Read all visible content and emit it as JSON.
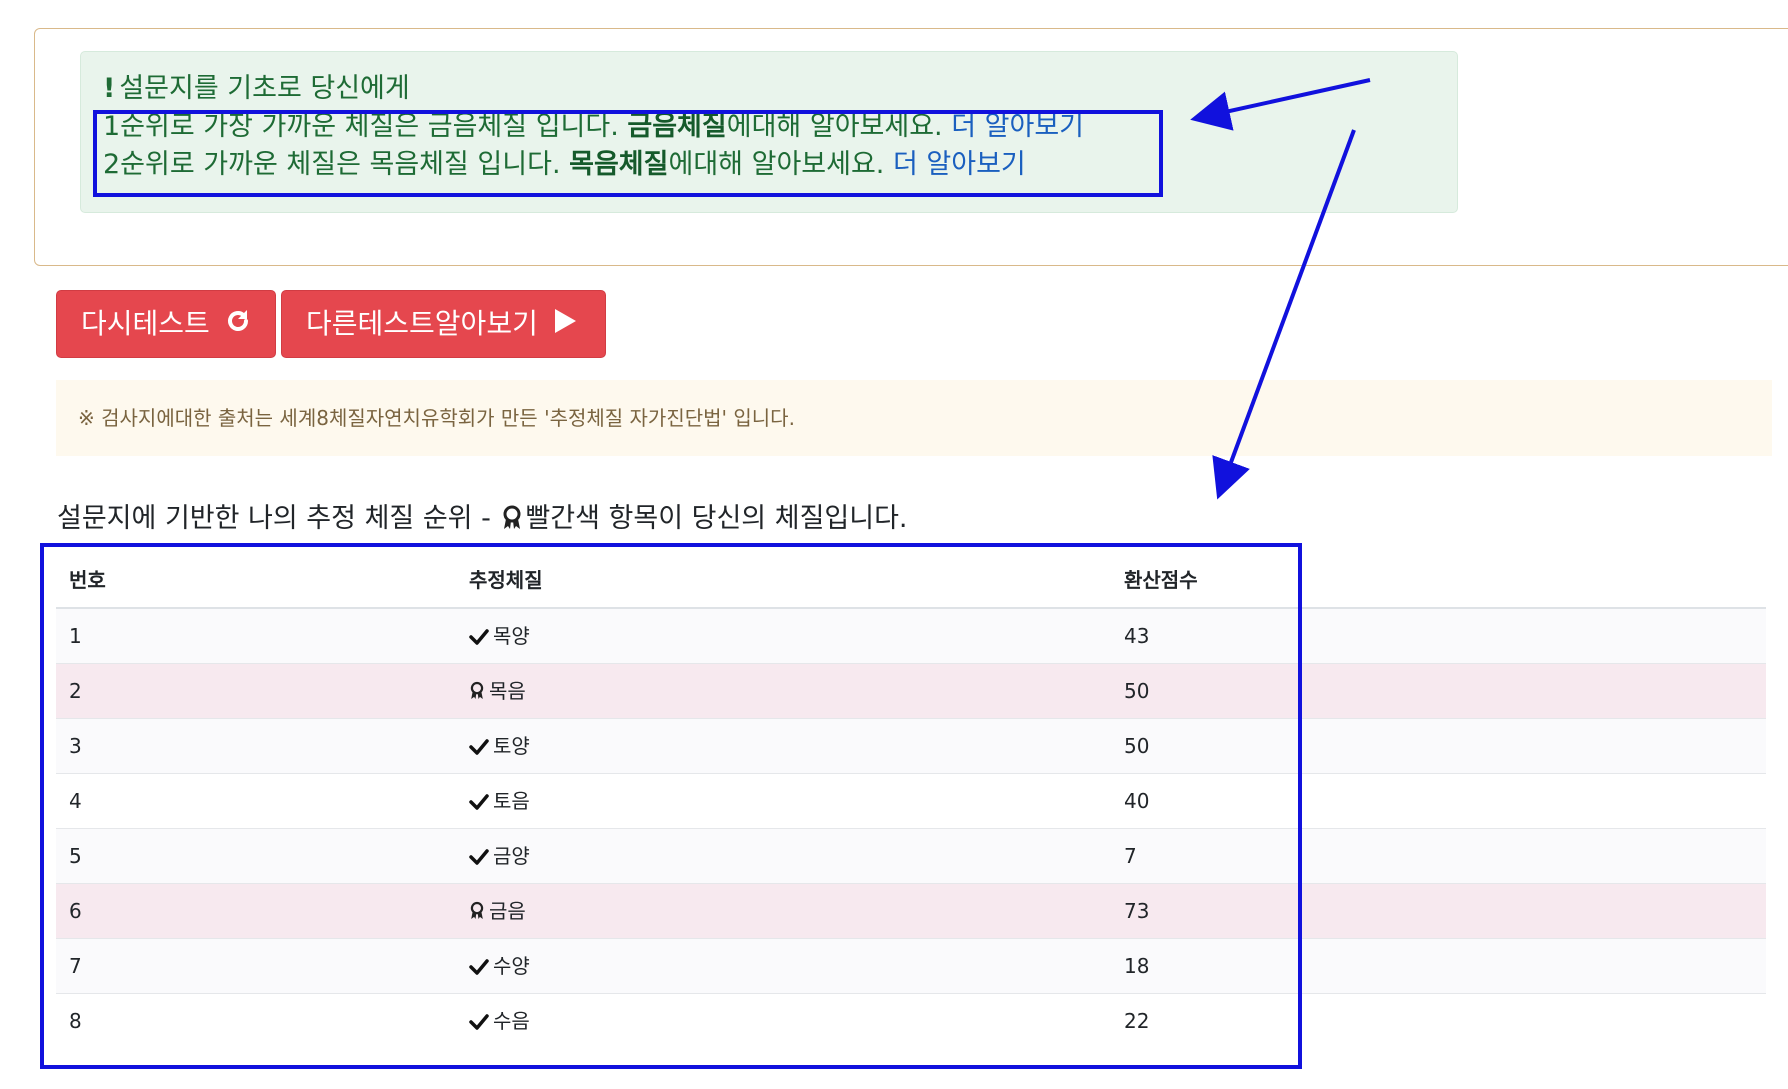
{
  "alert": {
    "line1": "설문지를 기초로 당신에게",
    "line2_text": "1순위로 가장 가까운 체질은 금음체질 입니다. ",
    "line2_bold": "금음체질",
    "line2_suffix": "에대해 알아보세요. ",
    "line2_link": "더 알아보기",
    "line3_text": "2순위로 가까운 체질은 목음체질 입니다. ",
    "line3_bold": "목음체질",
    "line3_suffix": "에대해 알아보세요. ",
    "line3_link": "더 알아보기"
  },
  "buttons": {
    "retest": "다시테스트",
    "other": "다른테스트알아보기"
  },
  "notice": "※ 검사지에대한 출처는 세계8체질자연치유학회가 만든 '추정체질 자가진단법' 입니다.",
  "section": {
    "title_pre": "설문지에 기반한 나의 추정 체질 순위 - ",
    "title_post": "빨간색 항목이 당신의 체질입니다."
  },
  "table": {
    "headers": [
      "번호",
      "추정체질",
      "환산점수"
    ],
    "rows": [
      {
        "num": "1",
        "type": "목양",
        "score": "43",
        "icon": "check-icon",
        "highlight": false
      },
      {
        "num": "2",
        "type": "목음",
        "score": "50",
        "icon": "award-icon",
        "highlight": true
      },
      {
        "num": "3",
        "type": "토양",
        "score": "50",
        "icon": "check-icon",
        "highlight": false
      },
      {
        "num": "4",
        "type": "토음",
        "score": "40",
        "icon": "check-icon",
        "highlight": false
      },
      {
        "num": "5",
        "type": "금양",
        "score": "7",
        "icon": "check-icon",
        "highlight": false
      },
      {
        "num": "6",
        "type": "금음",
        "score": "73",
        "icon": "award-icon",
        "highlight": true
      },
      {
        "num": "7",
        "type": "수양",
        "score": "18",
        "icon": "check-icon",
        "highlight": false
      },
      {
        "num": "8",
        "type": "수음",
        "score": "22",
        "icon": "check-icon",
        "highlight": false
      }
    ]
  },
  "colors": {
    "alert_bg": "#e9f4ec",
    "alert_text": "#1e6b35",
    "link": "#1a5fbf",
    "button": "#e5474e",
    "notice_bg": "#fef9ee",
    "highlight_row": "#f7e9ef",
    "annotation": "#1111dd"
  }
}
